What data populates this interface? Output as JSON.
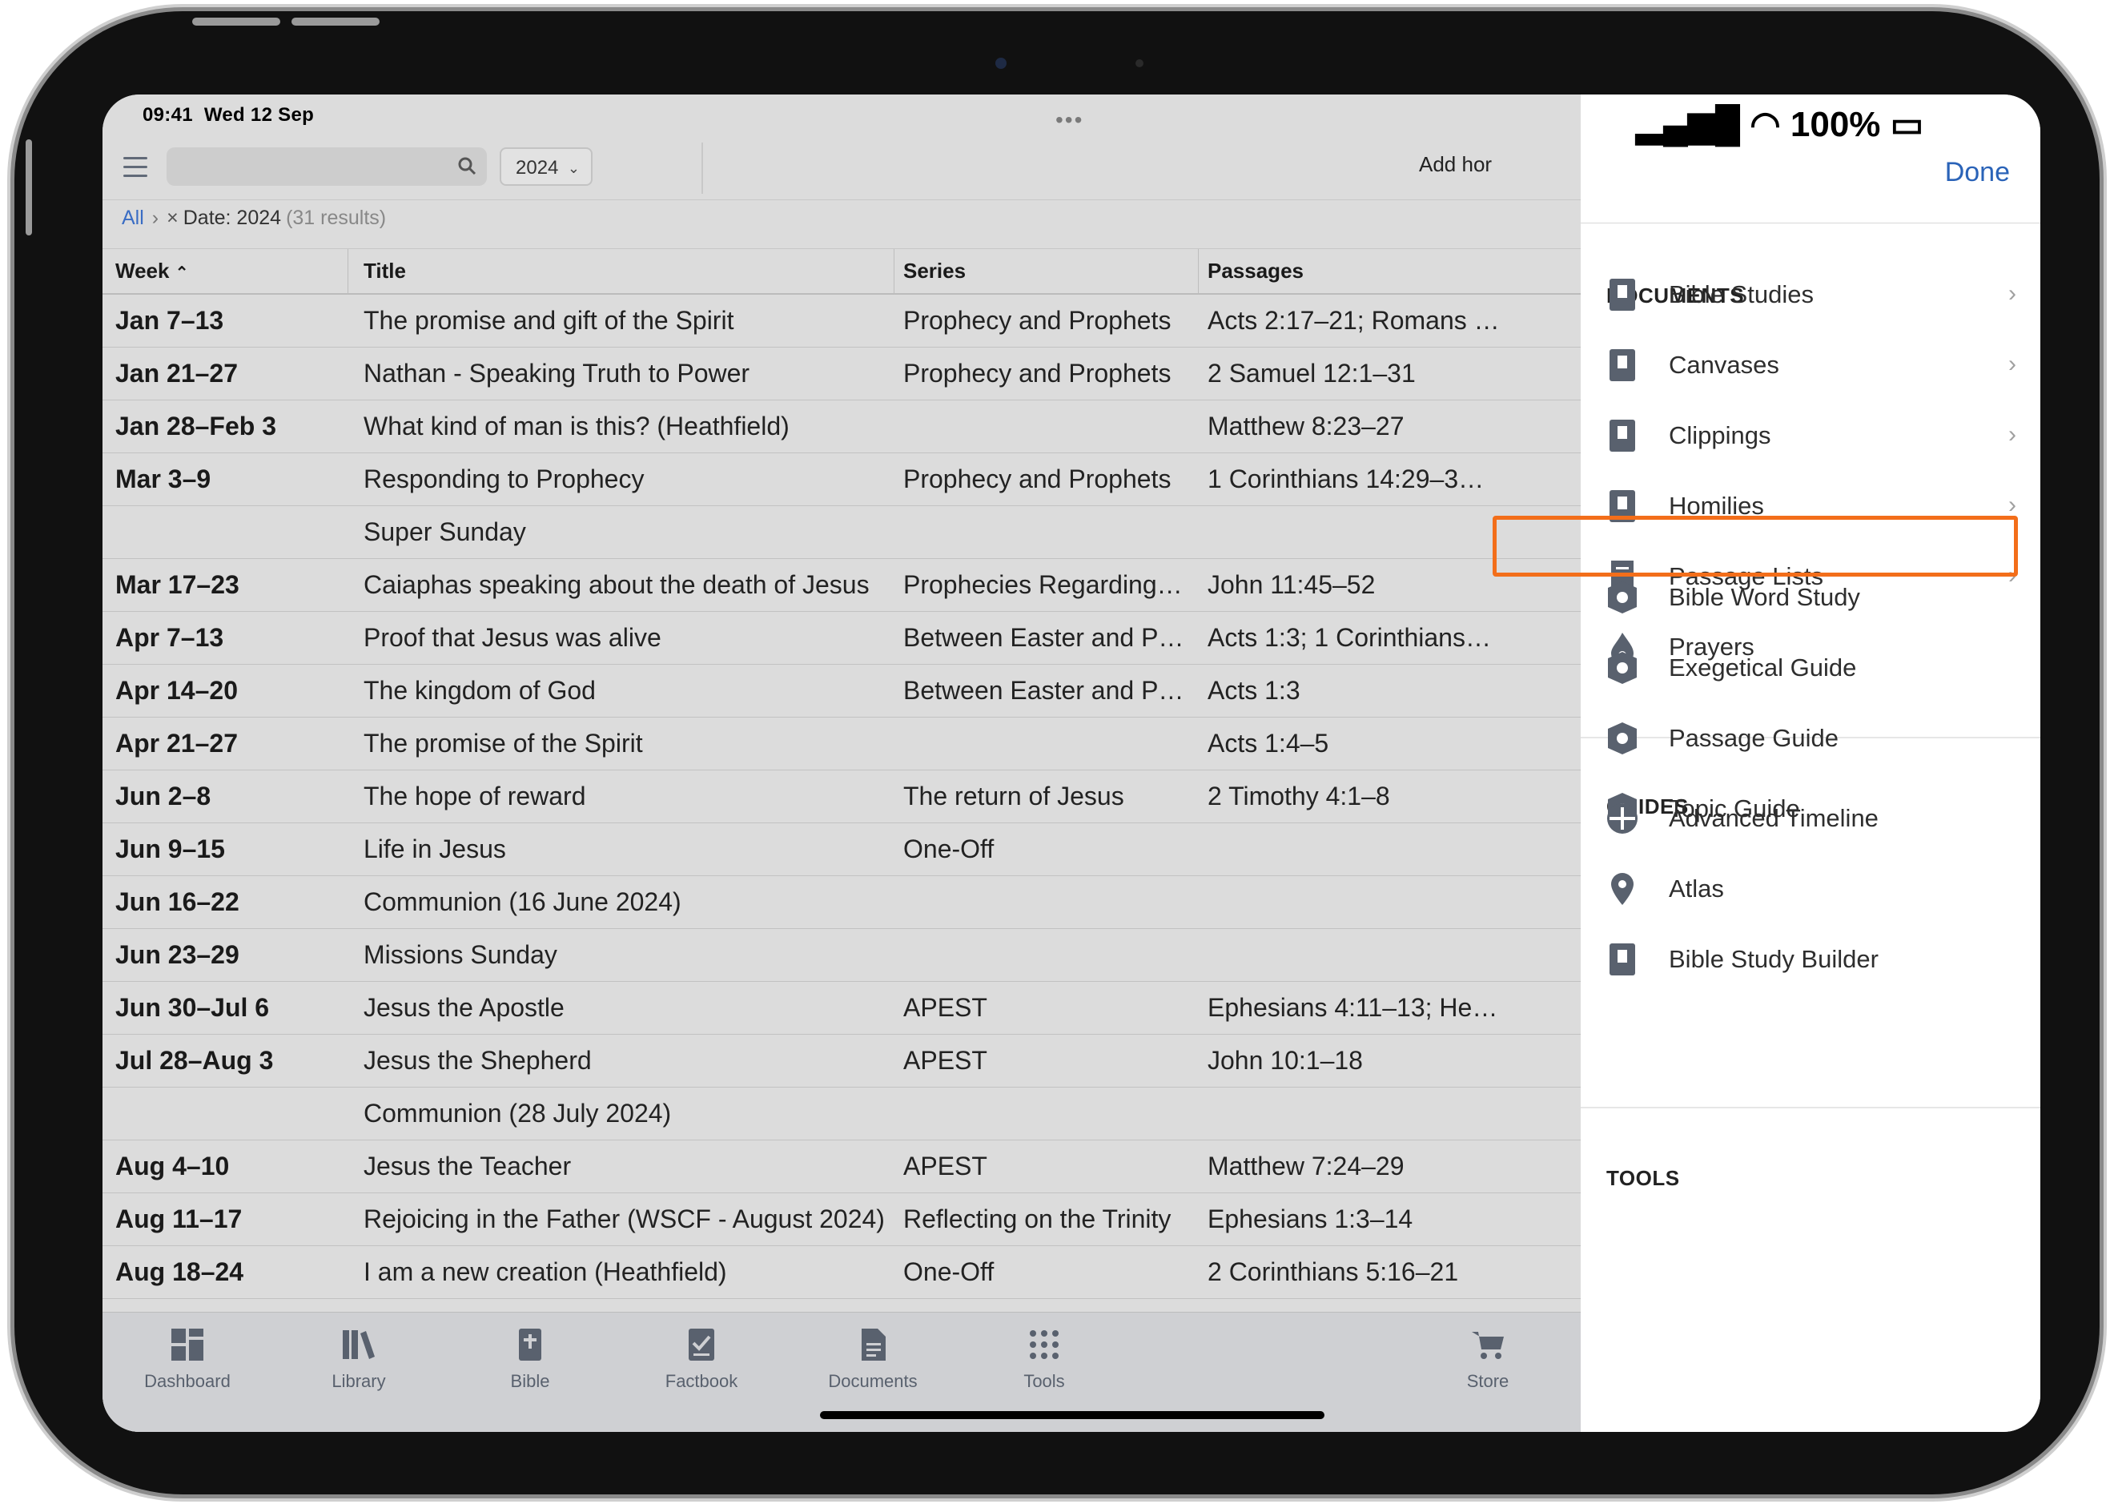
{
  "status": {
    "time": "09:41",
    "date": "Wed 12 Sep",
    "battery": "100%"
  },
  "toolbar": {
    "year": "2024",
    "add_home": "Add hor",
    "search_value": ""
  },
  "breadcrumb": {
    "all": "All",
    "filter": "Date: 2024",
    "results": "(31 results)"
  },
  "table": {
    "headers": {
      "week": "Week",
      "title": "Title",
      "series": "Series",
      "passages": "Passages"
    },
    "rows": [
      {
        "week": "Jan 7–13",
        "title": "The promise and gift of the Spirit",
        "series": "Prophecy and Prophets",
        "passages": "Acts 2:17–21; Romans …"
      },
      {
        "week": "Jan 21–27",
        "title": "Nathan - Speaking Truth to Power",
        "series": "Prophecy and Prophets",
        "passages": "2 Samuel 12:1–31"
      },
      {
        "week": "Jan 28–Feb 3",
        "title": "What kind of man is this? (Heathfield)",
        "series": "",
        "passages": "Matthew 8:23–27"
      },
      {
        "week": "Mar 3–9",
        "title": "Responding to Prophecy",
        "series": "Prophecy and Prophets",
        "passages": "1 Corinthians 14:29–3…"
      },
      {
        "week": "",
        "title": "Super Sunday",
        "series": "",
        "passages": ""
      },
      {
        "week": "Mar 17–23",
        "title": "Caiaphas speaking about the death of Jesus",
        "series": "Prophecies Regarding…",
        "passages": "John 11:45–52"
      },
      {
        "week": "Apr 7–13",
        "title": "Proof that Jesus was alive",
        "series": "Between Easter and P…",
        "passages": "Acts 1:3; 1 Corinthians…"
      },
      {
        "week": "Apr 14–20",
        "title": "The kingdom of God",
        "series": "Between Easter and P…",
        "passages": "Acts 1:3"
      },
      {
        "week": "Apr 21–27",
        "title": "The promise of the Spirit",
        "series": "",
        "passages": "Acts 1:4–5"
      },
      {
        "week": "Jun 2–8",
        "title": "The hope of reward",
        "series": "The return of Jesus",
        "passages": "2 Timothy 4:1–8"
      },
      {
        "week": "Jun 9–15",
        "title": "Life in Jesus",
        "series": "One-Off",
        "passages": ""
      },
      {
        "week": "Jun 16–22",
        "title": "Communion (16 June 2024)",
        "series": "",
        "passages": ""
      },
      {
        "week": "Jun 23–29",
        "title": "Missions Sunday",
        "series": "",
        "passages": ""
      },
      {
        "week": "Jun 30–Jul 6",
        "title": "Jesus the Apostle",
        "series": "APEST",
        "passages": "Ephesians 4:11–13; He…"
      },
      {
        "week": "Jul 28–Aug 3",
        "title": "Jesus the Shepherd",
        "series": "APEST",
        "passages": "John 10:1–18"
      },
      {
        "week": "",
        "title": "Communion (28 July 2024)",
        "series": "",
        "passages": ""
      },
      {
        "week": "Aug 4–10",
        "title": "Jesus the Teacher",
        "series": "APEST",
        "passages": "Matthew 7:24–29"
      },
      {
        "week": "Aug 11–17",
        "title": "Rejoicing in the Father (WSCF - August 2024)",
        "series": "Reflecting on the Trinity",
        "passages": "Ephesians 1:3–14"
      },
      {
        "week": "Aug 18–24",
        "title": "I am a new creation (Heathfield)",
        "series": "One-Off",
        "passages": "2 Corinthians 5:16–21"
      }
    ]
  },
  "tabbar": {
    "dashboard": "Dashboard",
    "library": "Library",
    "bible": "Bible",
    "factbook": "Factbook",
    "documents": "Documents",
    "tools": "Tools",
    "store": "Store"
  },
  "panel": {
    "done": "Done",
    "documents": {
      "heading": "DOCUMENTS",
      "items": [
        "Bible Studies",
        "Canvases",
        "Clippings",
        "Homilies",
        "Passage Lists",
        "Prayers"
      ]
    },
    "guides": {
      "heading": "GUIDES",
      "items": [
        "Bible Word Study",
        "Exegetical Guide",
        "Passage Guide",
        "Topic Guide"
      ]
    },
    "tools": {
      "heading": "TOOLS",
      "items": [
        "Advanced Timeline",
        "Atlas",
        "Bible Study Builder"
      ]
    }
  },
  "colors": {
    "highlight": "#f36e1a",
    "accent": "#2a63b8",
    "link": "#3a6dc4"
  }
}
